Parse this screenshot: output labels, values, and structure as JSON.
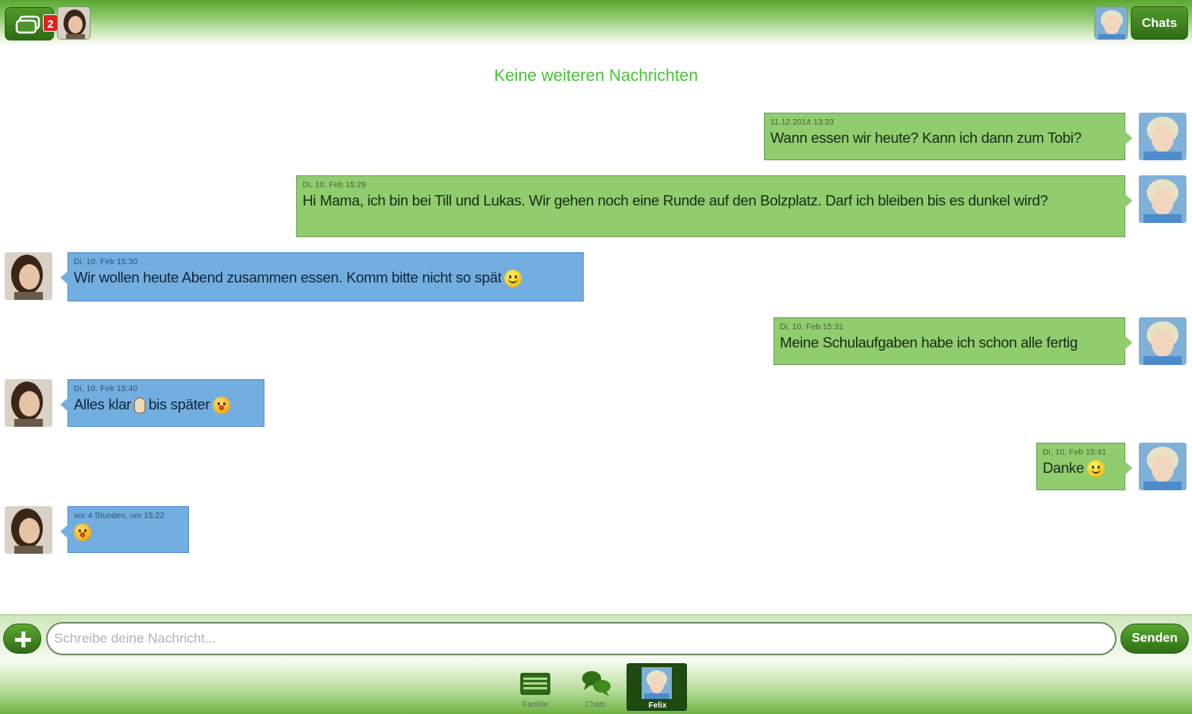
{
  "topbar": {
    "unread_count": "2",
    "chats_label": "Chats"
  },
  "conversation": {
    "no_more_label": "Keine weiteren Nachrichten",
    "messages": [
      {
        "direction": "out",
        "time": "11.12.2014 13:33",
        "text": "Wann essen wir heute? Kann ich dann zum Tobi?"
      },
      {
        "direction": "out",
        "time": "Di, 10. Feb 15:29",
        "text": "Hi Mama, ich bin bei Till und Lukas. Wir gehen noch eine Runde auf den Bolzplatz. Darf ich bleiben bis es dunkel wird?"
      },
      {
        "direction": "in",
        "time": "Di, 10. Feb 15:30",
        "text": "Wir wollen heute Abend zusammen essen. Komm bitte nicht so spät",
        "emoji": "smiley-icon"
      },
      {
        "direction": "out",
        "time": "Di, 10. Feb 15:31",
        "text": "Meine Schulaufgaben habe ich schon alle fertig"
      },
      {
        "direction": "in",
        "time": "Di, 10. Feb 15:40",
        "text_a": "Alles klar",
        "text_b": "bis später",
        "emoji_a": "thumbs-up-icon",
        "emoji_b": "wink-kiss-icon"
      },
      {
        "direction": "out",
        "time": "Di, 10. Feb 15:41",
        "text": "Danke",
        "emoji": "smiley-icon"
      },
      {
        "direction": "in",
        "time": "vor 4 Stunden, um 15:22",
        "emoji": "wink-kiss-icon"
      }
    ]
  },
  "compose": {
    "placeholder": "Schreibe deine Nachricht...",
    "send_label": "Senden"
  },
  "bottom_nav": {
    "items": [
      {
        "label": "Familie",
        "icon": "family-board-icon"
      },
      {
        "label": "Chats",
        "icon": "chat-bubbles-icon"
      },
      {
        "label": "Felix",
        "icon": "user-avatar-icon",
        "active": true
      }
    ]
  },
  "colors": {
    "brand_green": "#3f8a1f",
    "outgoing_bubble": "#8fcd6e",
    "incoming_bubble": "#72aedf",
    "no_more_text": "#44c433",
    "badge_red": "#d9241f"
  }
}
